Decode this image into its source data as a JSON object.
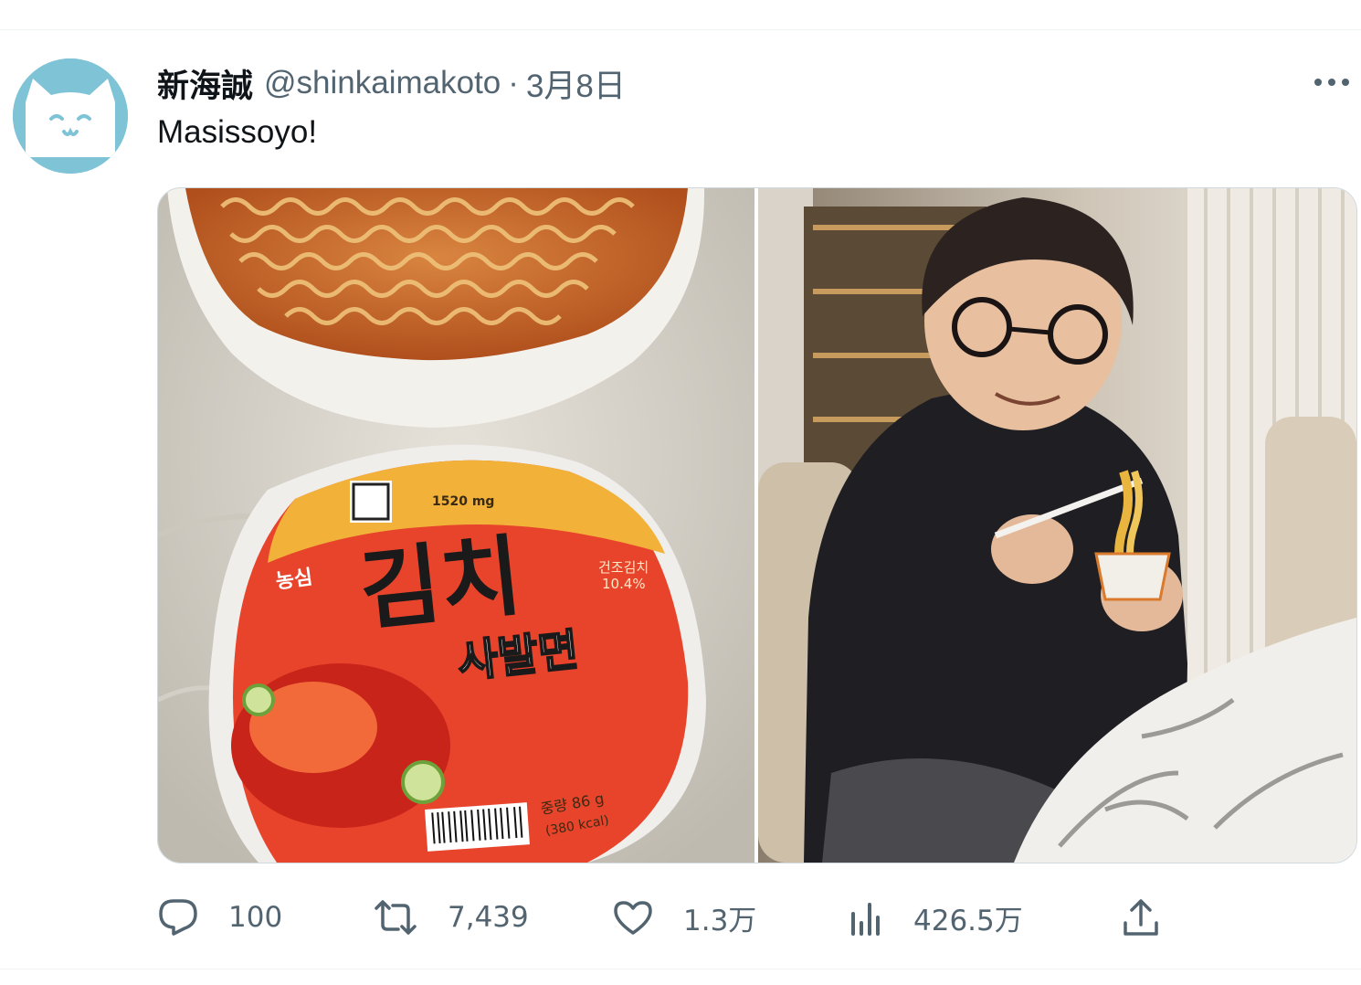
{
  "tweet": {
    "author": {
      "display_name": "新海誠",
      "handle": "@shinkaimakoto",
      "avatar_color": "#7ec3d6"
    },
    "separator": "·",
    "date": "3月8日",
    "text": "Masissoyo!",
    "more_icon": "more-dots-icon",
    "media": {
      "left_photo": {
        "package_brand": "농심",
        "package_title": "김치",
        "package_subtitle": "사발면",
        "sodium": "1520 mg",
        "dried_kimchi": "건조김치",
        "dried_kimchi_pct": "10.4%",
        "weight": "중량 86 g",
        "kcal": "(380 kcal)"
      }
    },
    "actions": {
      "reply": {
        "icon": "reply-icon",
        "count": "100"
      },
      "retweet": {
        "icon": "retweet-icon",
        "count": "7,439"
      },
      "like": {
        "icon": "heart-icon",
        "count": "1.3万"
      },
      "views": {
        "icon": "views-chart-icon",
        "count": "426.5万"
      },
      "share": {
        "icon": "share-icon"
      }
    }
  },
  "colors": {
    "text_primary": "#0f1419",
    "text_secondary": "#536471",
    "border": "#cfd9de"
  }
}
